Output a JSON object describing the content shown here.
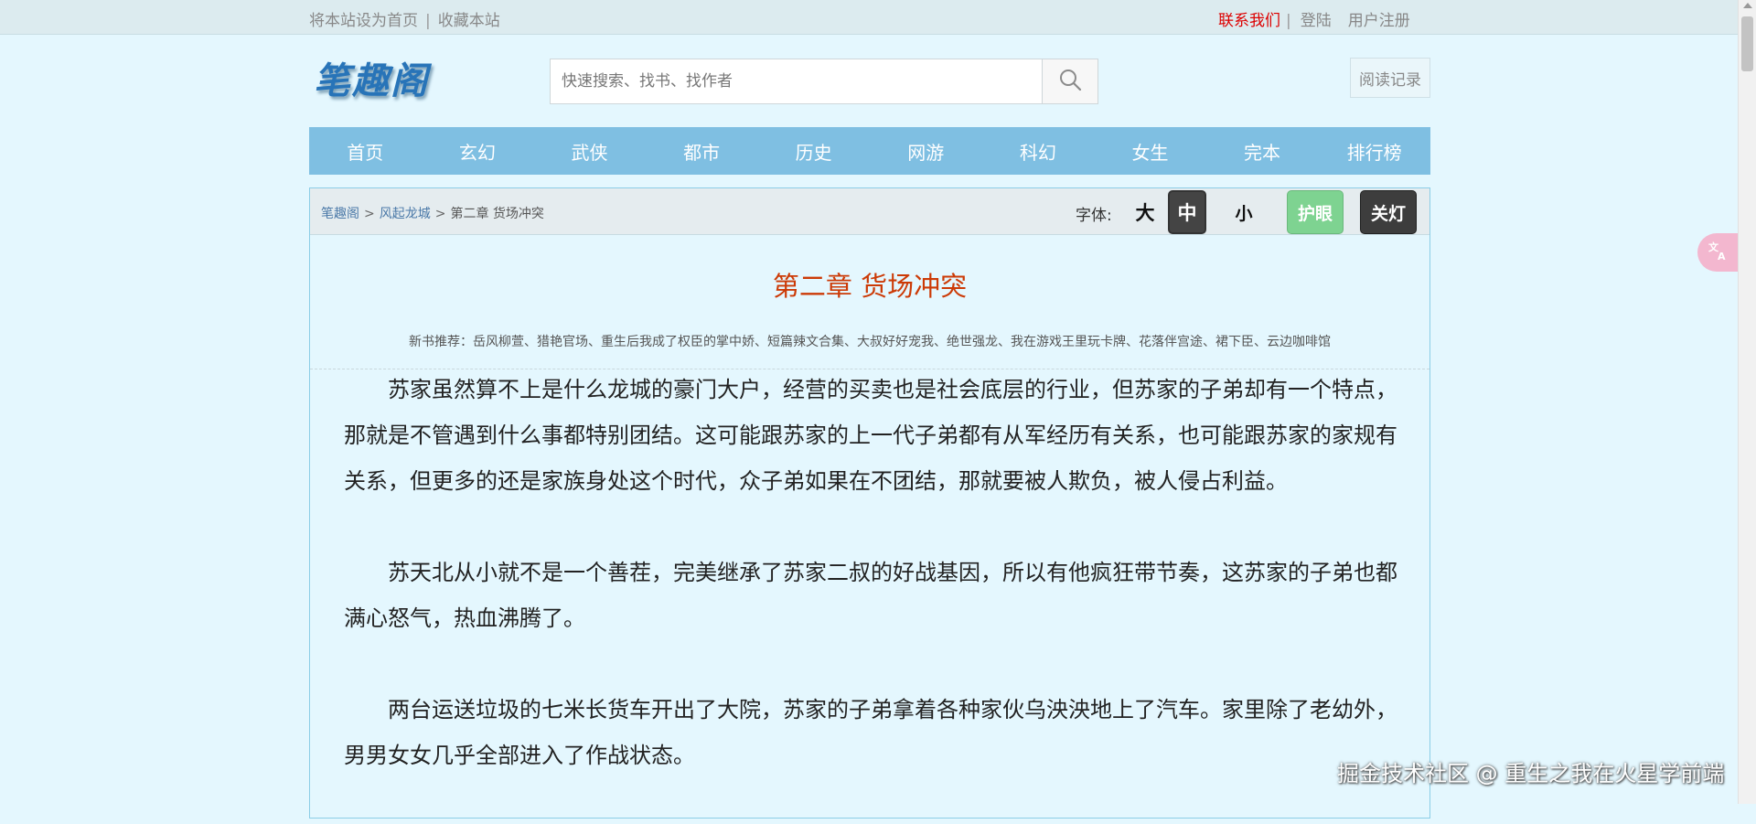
{
  "topbar": {
    "set_home": "将本站设为首页",
    "divider": "|",
    "bookmark": "收藏本站",
    "contact": "联系我们",
    "login": "登陆",
    "register": "用户注册"
  },
  "header": {
    "logo_text": "笔趣阁",
    "search_placeholder": "快速搜索、找书、找作者",
    "reading_history": "阅读记录"
  },
  "nav": {
    "items": [
      "首页",
      "玄幻",
      "武侠",
      "都市",
      "历史",
      "网游",
      "科幻",
      "女生",
      "完本",
      "排行榜"
    ]
  },
  "breadcrumb": {
    "site": "笔趣阁",
    "book": "风起龙城",
    "chapter": "第二章 货场冲突",
    "sep": ">"
  },
  "reader_tools": {
    "font_label": "字体:",
    "large": "大",
    "medium": "中",
    "small": "小",
    "eye_care": "护眼",
    "lights_off": "关灯"
  },
  "chapter": {
    "title": "第二章 货场冲突",
    "recommend": "新书推荐：岳风柳萱、猎艳官场、重生后我成了权臣的掌中娇、短篇辣文合集、大叔好好宠我、绝世强龙、我在游戏王里玩卡牌、花落伴宫途、裙下臣、云边咖啡馆",
    "paragraphs": [
      "苏家虽然算不上是什么龙城的豪门大户，经营的买卖也是社会底层的行业，但苏家的子弟却有一个特点，那就是不管遇到什么事都特别团结。这可能跟苏家的上一代子弟都有从军经历有关系，也可能跟苏家的家规有关系，但更多的还是家族身处这个时代，众子弟如果在不团结，那就要被人欺负，被人侵占利益。",
      "苏天北从小就不是一个善茬，完美继承了苏家二叔的好战基因，所以有他疯狂带节奏，这苏家的子弟也都满心怒气，热血沸腾了。",
      "两台运送垃圾的七米长货车开出了大院，苏家的子弟拿着各种家伙乌泱泱地上了汽车。家里除了老幼外，男男女女几乎全部进入了作战状态。"
    ]
  },
  "overlay": {
    "watermark": "掘金技术社区 @ 重生之我在火星学前端",
    "translate_icon": "translate-icon"
  },
  "colors": {
    "page_bg": "#e4f7fe",
    "nav_bg": "#7fbfe2",
    "title_red": "#cc3a06",
    "contact_red": "#dd0000",
    "eye_green": "#7ed391"
  }
}
